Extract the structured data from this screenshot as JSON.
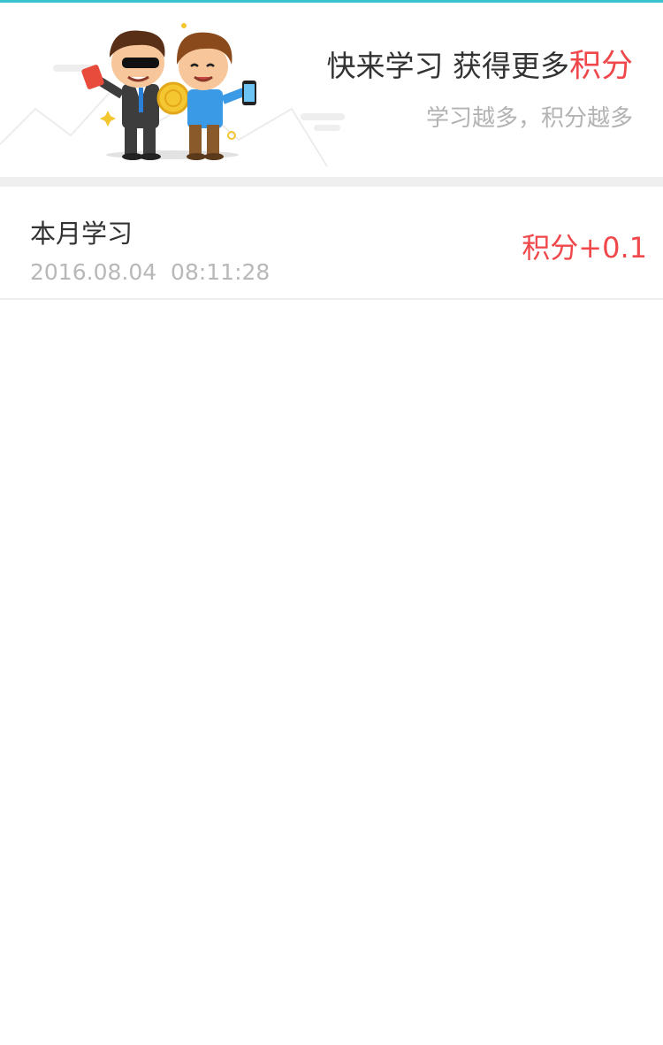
{
  "banner": {
    "headline": "快来学习 获得更多",
    "headline_accent": "积分",
    "subline": "学习越多，积分越多",
    "illustration_icon": "two-people-coin-illustration",
    "accent_color": "#f0474b"
  },
  "records": [
    {
      "title": "本月学习",
      "date": "2016.08.04",
      "time": "08:11:28",
      "points": "积分+0.1"
    }
  ]
}
